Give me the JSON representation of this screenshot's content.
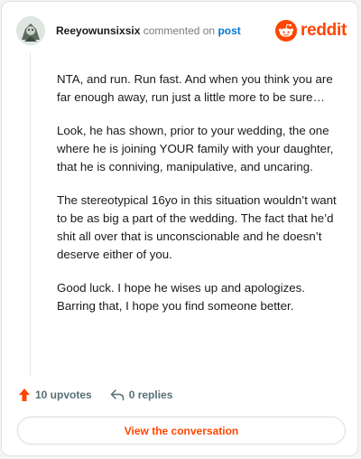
{
  "comment": {
    "username": "Reeyowunsixsix",
    "action_text": "commented on",
    "post_link": "post",
    "paragraphs": [
      "NTA, and run. Run fast. And when you think you are far enough away, run just a little more to be sure…",
      "Look, he has shown, prior to your wedding, the one where he is joining YOUR family with your daughter, that he is conniving, manipulative, and uncaring.",
      "The stereotypical 16yo in this situation wouldn’t want to be as big a part of the wedding. The fact that he’d shit all over that is unconscionable and he doesn’t deserve either of you.",
      "Good luck. I hope he wises up and apologizes. Barring that, I hope you find someone better."
    ]
  },
  "brand": {
    "wordmark": "reddit",
    "accent_color": "#ff4500",
    "link_color": "#0079d3"
  },
  "actions": {
    "upvotes": "10 upvotes",
    "replies": "0 replies"
  },
  "cta": {
    "label": "View the conversation"
  },
  "icons": {
    "upvote": "upvote-arrow-icon",
    "reply": "reply-arrow-icon",
    "logo": "reddit-snoo-icon",
    "avatar": "user-avatar"
  }
}
